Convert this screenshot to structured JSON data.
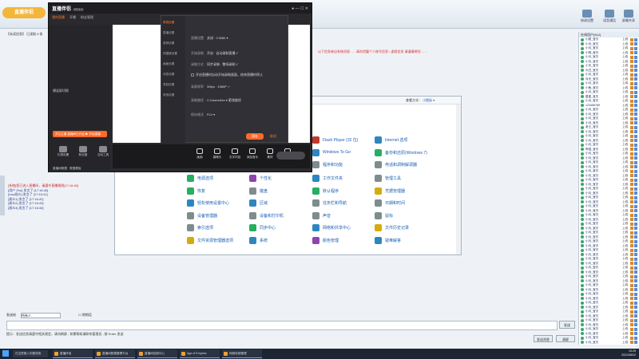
{
  "background_app": {
    "title_logo": "直播伴侣",
    "tools": [
      {
        "label": "修改设置",
        "icon": "settings-icon"
      },
      {
        "label": "语音通话",
        "icon": "voice-icon"
      },
      {
        "label": "屏幕共享",
        "icon": "screen-share-icon"
      }
    ],
    "chat_top_line": "【未读信息】 已读取 5 条",
    "red_notice": "以下信息来自系统消息……请勿泄露个人账号信息 / 虚假信息 请谨慎辨别 ……",
    "log_lines": [
      {
        "text": "[系统]您已进入直播间，请遵守直播规则[17:16:40]",
        "red": true
      },
      {
        "text": "[用户 Zhu] 发言了 [17:16:40]",
        "red": false
      },
      {
        "text": "[Lisa观众] 发言了 [17:16:41]",
        "red": false
      },
      {
        "text": "[观众1] 发言了 [17:16:42]",
        "red": false
      },
      {
        "text": "[观众2] 发言了 [17:16:43]",
        "red": false
      },
      {
        "text": "[观众3] 发言了 [17:16:45]",
        "red": false
      }
    ],
    "input_label": "发送给",
    "input_select": "所有人",
    "input_checkbox": "悄悄话",
    "send_label": "发送",
    "bottom_tip": "提示：发送信息请遵守相关规定，请勿刷屏 ; 如需帮助请联系管理员 ; 按 Enter 发送",
    "bottom_buttons": [
      "发送消息",
      "清屏"
    ],
    "user_list_header": "在线用户(512)",
    "users": [
      {
        "name": "小甜_宝贝",
        "rank": "上线"
      },
      {
        "name": "小月_宝贝",
        "rank": "上线"
      },
      {
        "name": "小月_宝贝",
        "rank": "上线"
      },
      {
        "name": "小明_宝贝",
        "rank": "上线"
      },
      {
        "name": "小月_宝贝",
        "rank": "上线"
      },
      {
        "name": "小月_宝贝",
        "rank": "上线"
      },
      {
        "name": "小天_宝贝",
        "rank": "上线"
      },
      {
        "name": "大白_宝贝",
        "rank": "上线"
      },
      {
        "name": "小月_宝贝",
        "rank": "上线"
      },
      {
        "name": "月光_宝贝",
        "rank": "上线"
      },
      {
        "name": "小月_宝贝",
        "rank": "上线"
      },
      {
        "name": "小鱼_宝贝",
        "rank": "上线"
      },
      {
        "name": "小月_宝贝",
        "rank": "上线"
      },
      {
        "name": "星星_宝贝",
        "rank": "上线"
      },
      {
        "name": "小月_宝贝",
        "rank": "上线"
      },
      {
        "name": "123456789",
        "rank": "上线"
      },
      {
        "name": "小月_宝贝",
        "rank": "上线"
      },
      {
        "name": "小月_宝贝",
        "rank": "上线"
      },
      {
        "name": "小月_宝贝",
        "rank": "上线"
      },
      {
        "name": "小月_宝贝",
        "rank": "上线"
      },
      {
        "name": "老王_宝贝",
        "rank": "上线"
      },
      {
        "name": "小月_宝贝",
        "rank": "上线"
      },
      {
        "name": "小月_宝贝",
        "rank": "上线"
      },
      {
        "name": "小月_宝贝",
        "rank": "上线"
      },
      {
        "name": "小月_宝贝",
        "rank": "上线"
      },
      {
        "name": "阿强_宝贝",
        "rank": "上线"
      },
      {
        "name": "小月_宝贝",
        "rank": "上线"
      },
      {
        "name": "小月_宝贝",
        "rank": "上线"
      },
      {
        "name": "小月_宝贝",
        "rank": "上线"
      },
      {
        "name": "小月_宝贝",
        "rank": "上线"
      },
      {
        "name": "小月_宝贝",
        "rank": "上线"
      },
      {
        "name": "小月_宝贝",
        "rank": "上线"
      },
      {
        "name": "小月_宝贝",
        "rank": "上线"
      },
      {
        "name": "小月_宝贝",
        "rank": "上线"
      },
      {
        "name": "小月_宝贝",
        "rank": "上线"
      },
      {
        "name": "小月_宝贝",
        "rank": "上线"
      },
      {
        "name": "小月_宝贝",
        "rank": "上线"
      },
      {
        "name": "小月_宝贝",
        "rank": "上线"
      },
      {
        "name": "小月_宝贝",
        "rank": "上线"
      },
      {
        "name": "小月_宝贝",
        "rank": "上线"
      },
      {
        "name": "小月_宝贝",
        "rank": "上线"
      },
      {
        "name": "小月_宝贝",
        "rank": "上线"
      },
      {
        "name": "小月_宝贝",
        "rank": "上线"
      },
      {
        "name": "小月_宝贝",
        "rank": "上线"
      },
      {
        "name": "小月_宝贝",
        "rank": "上线"
      },
      {
        "name": "小月_宝贝",
        "rank": "上线"
      },
      {
        "name": "小月_宝贝",
        "rank": "上线"
      },
      {
        "name": "小月_宝贝",
        "rank": "上线"
      },
      {
        "name": "小月_宝贝",
        "rank": "上线"
      },
      {
        "name": "小月_宝贝",
        "rank": "上线"
      },
      {
        "name": "小月_宝贝",
        "rank": "上线"
      },
      {
        "name": "小月_宝贝",
        "rank": "上线"
      },
      {
        "name": "小月_宝贝",
        "rank": "上线"
      },
      {
        "name": "小月_宝贝",
        "rank": "上线"
      },
      {
        "name": "小月_宝贝",
        "rank": "上线"
      },
      {
        "name": "小月_宝贝",
        "rank": "上线"
      },
      {
        "name": "小月_宝贝",
        "rank": "上线"
      },
      {
        "name": "小月_宝贝",
        "rank": "上线"
      },
      {
        "name": "小月_宝贝",
        "rank": "上线"
      },
      {
        "name": "小月_宝贝",
        "rank": "上线"
      },
      {
        "name": "小月_宝贝",
        "rank": "上线"
      },
      {
        "name": "小月_宝贝",
        "rank": "上线"
      },
      {
        "name": "小月_宝贝",
        "rank": "上线"
      },
      {
        "name": "小月_宝贝",
        "rank": "上线"
      },
      {
        "name": "小月_宝贝",
        "rank": "上线"
      },
      {
        "name": "小月_宝贝",
        "rank": "上线"
      },
      {
        "name": "小月_宝贝",
        "rank": "上线"
      },
      {
        "name": "小月_宝贝",
        "rank": "上线"
      },
      {
        "name": "小月_宝贝",
        "rank": "上线"
      },
      {
        "name": "小月_宝贝",
        "rank": "上线"
      }
    ]
  },
  "control_panel": {
    "view_by_label": "查看方式：",
    "view_by_value": "小图标 ▾",
    "items": [
      {
        "label": "Flash Player (32 位)",
        "color": "#c0392b"
      },
      {
        "label": "Internet 选项",
        "color": "#2e86c1"
      },
      {
        "label": "Windows To Go",
        "color": "#2e86c1"
      },
      {
        "label": "备份和还原(Windows 7)",
        "color": "#27ae60"
      },
      {
        "label": "程序和功能",
        "color": "#7f8c8d"
      },
      {
        "label": "电话和调制解调器",
        "color": "#7f8c8d"
      },
      {
        "label": "电源选项",
        "color": "#27ae60"
      },
      {
        "label": "个性化",
        "color": "#8e44ad"
      },
      {
        "label": "工作文件夹",
        "color": "#2e86c1"
      },
      {
        "label": "管理工具",
        "color": "#7f8c8d"
      },
      {
        "label": "恢复",
        "color": "#27ae60"
      },
      {
        "label": "键盘",
        "color": "#7f8c8d"
      },
      {
        "label": "默认程序",
        "color": "#27ae60"
      },
      {
        "label": "凭据管理器",
        "color": "#d4ac0d"
      },
      {
        "label": "轻松使用设置中心",
        "color": "#2e86c1"
      },
      {
        "label": "区域",
        "color": "#2e86c1"
      },
      {
        "label": "任务栏和导航",
        "color": "#7f8c8d"
      },
      {
        "label": "日期和时间",
        "color": "#7f8c8d"
      },
      {
        "label": "设备管理器",
        "color": "#7f8c8d"
      },
      {
        "label": "设备和打印机",
        "color": "#7f8c8d"
      },
      {
        "label": "声音",
        "color": "#7f8c8d"
      },
      {
        "label": "鼠标",
        "color": "#7f8c8d"
      },
      {
        "label": "索引选项",
        "color": "#7f8c8d"
      },
      {
        "label": "同步中心",
        "color": "#27ae60"
      },
      {
        "label": "网络和共享中心",
        "color": "#2e86c1"
      },
      {
        "label": "文件历史记录",
        "color": "#d4ac0d"
      },
      {
        "label": "文件资源管理器选项",
        "color": "#d4ac0d"
      },
      {
        "label": "系统",
        "color": "#2e86c1"
      },
      {
        "label": "颜色管理",
        "color": "#8e44ad"
      },
      {
        "label": "疑难解答",
        "color": "#2e86c1"
      },
      {
        "label": "用户帐户",
        "color": "#2e86c1"
      },
      {
        "label": "语音识别",
        "color": "#7f8c8d"
      },
      {
        "label": "自动播放",
        "color": "#27ae60"
      },
      {
        "label": "字体",
        "color": "#d4ac0d"
      }
    ]
  },
  "live_app": {
    "logo": "直播伴侣",
    "version": "V7.1.1",
    "tabs": [
      "我的直播",
      "开播",
      "粉丝管理"
    ],
    "active_tab_index": 0,
    "left_labels": [
      "横竖屏切换",
      "直播间管理",
      "素材库"
    ],
    "orange_banner": "关注主播 直播间已开启 ▶ 开始直播",
    "grid": [
      {
        "label": "礼物设置"
      },
      {
        "label": "粉丝团"
      },
      {
        "label": "互动工具"
      },
      {
        "label": "连麦"
      },
      {
        "label": "PK"
      },
      {
        "label": "抽奖"
      }
    ],
    "bottom_left": "直播间数据 · 数据看板",
    "toolbar": [
      {
        "label": "画面"
      },
      {
        "label": "摄像头"
      },
      {
        "label": "文字内容"
      },
      {
        "label": "添加音乐"
      },
      {
        "label": "素材"
      },
      {
        "label": "投屏"
      }
    ],
    "start_live": ""
  },
  "settings_dialog": {
    "nav": [
      "常规设置",
      "直播设置",
      "音频设置",
      "快捷键设置",
      "画面设置",
      "消息设置",
      "录制设置",
      "其他设置"
    ],
    "active_nav_index": 0,
    "rows": [
      {
        "key": "直播设置",
        "value": "关闭  ·  C3080 ▾"
      },
      {
        "key": "开始录制",
        "value": "开启 · 自动录制直播 ✓"
      },
      {
        "key": "录制方式",
        "value": "同步录制 · 整场录制 ✓"
      },
      {
        "key": "",
        "value": "开启直播时自动开始录制画面，结束直播时停止"
      },
      {
        "key": "录屏帧率",
        "value": "30fps · 1080P ✓"
      },
      {
        "key": "录制路径",
        "value": "C:/Users/live ▾  更改路径"
      },
      {
        "key": "保存格式",
        "value": "FLV ▾"
      }
    ],
    "save": "保存",
    "cancel": "取消"
  },
  "taskbar": {
    "search": "在这里输入你要搜索",
    "apps": [
      "直播伴侣",
      "直播间数据管理平台",
      "直播间控制中心",
      "Age of Empires",
      "网络电视管理"
    ],
    "time": "19:25",
    "date": "2021/08/22"
  }
}
